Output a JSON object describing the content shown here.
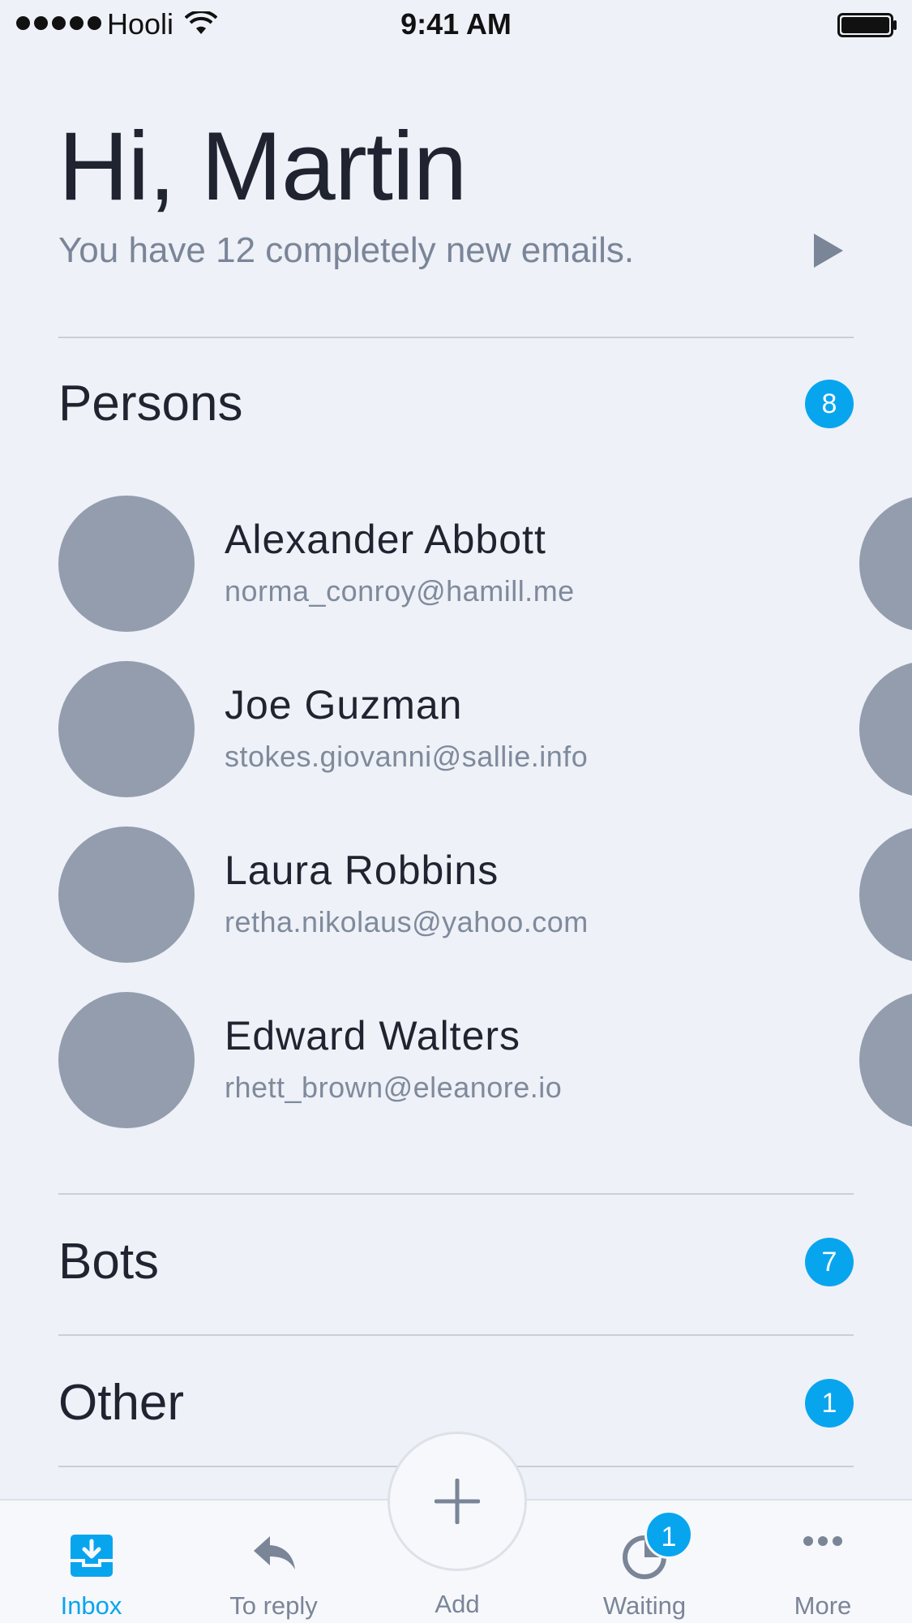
{
  "status_bar": {
    "carrier": "Hooli",
    "time": "9:41 AM"
  },
  "header": {
    "greeting": "Hi, Martin",
    "subtitle": "You have 12 completely new emails."
  },
  "sections": {
    "persons": {
      "title": "Persons",
      "count": "8",
      "items": [
        {
          "name": "Alexander Abbott",
          "email": "norma_conroy@hamill.me"
        },
        {
          "name": "Joe Guzman",
          "email": "stokes.giovanni@sallie.info"
        },
        {
          "name": "Laura Robbins",
          "email": "retha.nikolaus@yahoo.com"
        },
        {
          "name": "Edward Walters",
          "email": "rhett_brown@eleanore.io"
        }
      ]
    },
    "bots": {
      "title": "Bots",
      "count": "7"
    },
    "other": {
      "title": "Other",
      "count": "1"
    }
  },
  "tab_bar": {
    "tabs": [
      {
        "label": "Inbox",
        "icon": "inbox-icon",
        "active": true
      },
      {
        "label": "To reply",
        "icon": "reply-icon",
        "active": false
      },
      {
        "label": "Add",
        "icon": "plus-icon",
        "active": false
      },
      {
        "label": "Waiting",
        "icon": "waiting-icon",
        "active": false,
        "badge": "1"
      },
      {
        "label": "More",
        "icon": "more-icon",
        "active": false
      }
    ]
  },
  "colors": {
    "accent": "#08a5ef",
    "background": "#eef1f7",
    "avatar": "#939dae",
    "muted_text": "#7a8598"
  }
}
